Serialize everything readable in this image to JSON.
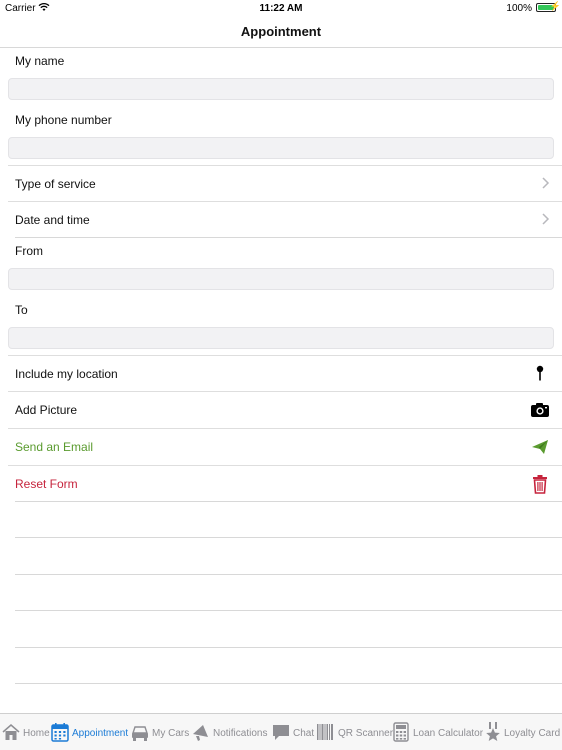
{
  "status_bar": {
    "carrier": "Carrier",
    "time": "11:22 AM",
    "battery": "100%"
  },
  "nav": {
    "title": "Appointment"
  },
  "form": {
    "name_label": "My name",
    "name_value": "",
    "phone_label": "My phone number",
    "phone_value": "",
    "service_label": "Type of service",
    "datetime_label": "Date and time",
    "from_label": "From",
    "from_value": "",
    "to_label": "To",
    "to_value": "",
    "location_label": "Include my location",
    "picture_label": "Add Picture",
    "email_label": "Send an Email",
    "reset_label": "Reset Form"
  },
  "colors": {
    "accent": "#1b7bd6",
    "send_email": "#5a9b2f",
    "reset": "#c6243d"
  },
  "tabs": [
    {
      "label": "Home",
      "icon": "home-icon",
      "active": false
    },
    {
      "label": "Appointment",
      "icon": "calendar-icon",
      "active": true
    },
    {
      "label": "My Cars",
      "icon": "car-icon",
      "active": false
    },
    {
      "label": "Notifications",
      "icon": "megaphone-icon",
      "active": false
    },
    {
      "label": "Chat",
      "icon": "chat-icon",
      "active": false
    },
    {
      "label": "QR Scanner",
      "icon": "barcode-icon",
      "active": false
    },
    {
      "label": "Loan Calculator",
      "icon": "calculator-icon",
      "active": false
    },
    {
      "label": "Loyalty Card",
      "icon": "star-medal-icon",
      "active": false
    }
  ]
}
